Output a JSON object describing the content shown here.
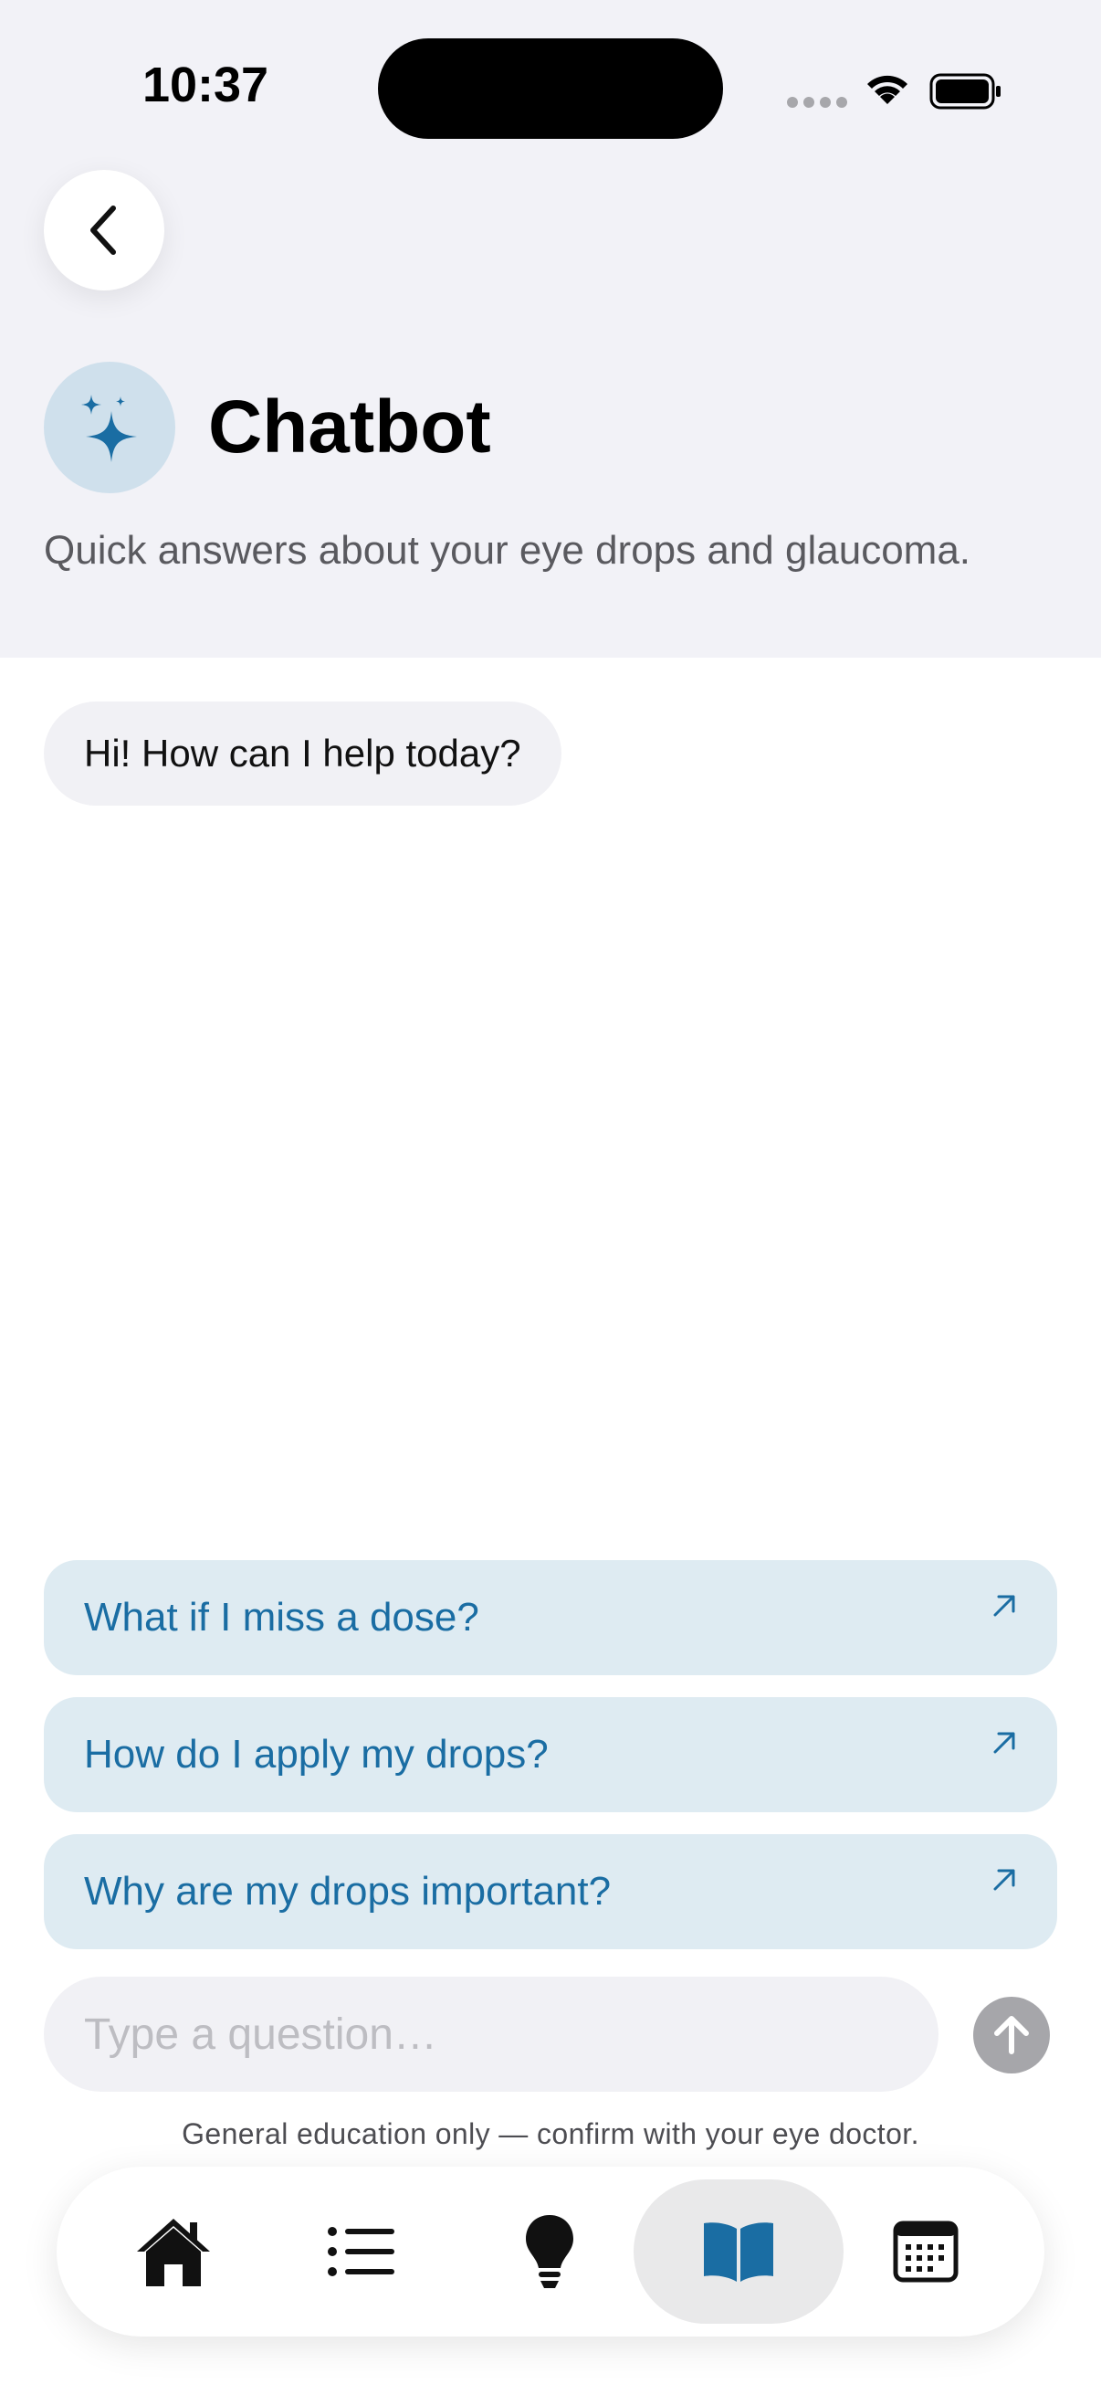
{
  "status_bar": {
    "time": "10:37"
  },
  "header": {
    "title": "Chatbot",
    "subtitle": "Quick answers about your eye drops and glaucoma."
  },
  "chat": {
    "messages": [
      {
        "from": "bot",
        "text": "Hi! How can I help today?"
      }
    ]
  },
  "suggestions": [
    {
      "label": "What if I miss a dose?"
    },
    {
      "label": "How do I apply my drops?"
    },
    {
      "label": "Why are my drops important?"
    }
  ],
  "input": {
    "placeholder": "Type a question…",
    "value": ""
  },
  "disclaimer": "General education only — confirm with your eye doctor.",
  "tabbar": {
    "active": "learn",
    "items": [
      {
        "id": "home",
        "icon": "house-icon"
      },
      {
        "id": "list",
        "icon": "list-icon"
      },
      {
        "id": "tips",
        "icon": "lightbulb-icon"
      },
      {
        "id": "learn",
        "icon": "book-icon"
      },
      {
        "id": "calendar",
        "icon": "calendar-icon"
      }
    ]
  },
  "colors": {
    "accent": "#1a6da3",
    "suggestion_bg": "#deebf2",
    "header_bg": "#f2f2f7",
    "badge_bg": "#cfe0ec"
  }
}
